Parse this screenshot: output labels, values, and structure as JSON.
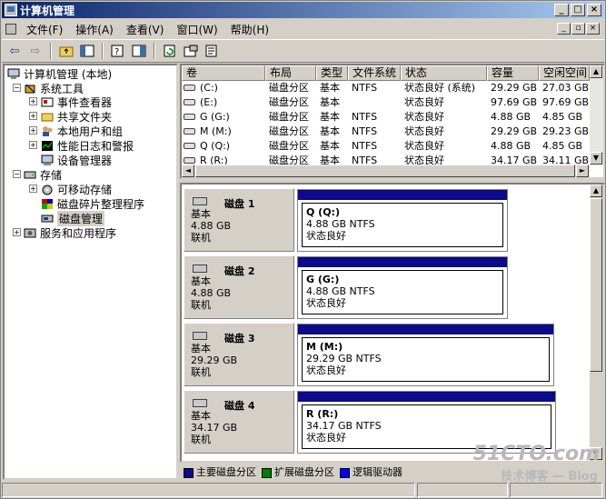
{
  "window": {
    "title": "计算机管理"
  },
  "menu": [
    "文件(F)",
    "操作(A)",
    "查看(V)",
    "窗口(W)",
    "帮助(H)"
  ],
  "tree": {
    "root": "计算机管理 (本地)",
    "system_tools": "系统工具",
    "event_viewer": "事件查看器",
    "shared_folders": "共享文件夹",
    "local_users": "本地用户和组",
    "perf_logs": "性能日志和警报",
    "device_manager": "设备管理器",
    "storage": "存储",
    "removable": "可移动存储",
    "defrag": "磁盘碎片整理程序",
    "disk_mgmt": "磁盘管理",
    "services": "服务和应用程序"
  },
  "columns": [
    "卷",
    "布局",
    "类型",
    "文件系统",
    "状态",
    "容量",
    "空闲空间"
  ],
  "rows": [
    [
      "(C:)",
      "磁盘分区",
      "基本",
      "NTFS",
      "状态良好 (系统)",
      "29.29 GB",
      "27.03 GB"
    ],
    [
      "(E:)",
      "磁盘分区",
      "基本",
      "",
      "状态良好",
      "97.69 GB",
      "97.69 GB"
    ],
    [
      "G (G:)",
      "磁盘分区",
      "基本",
      "NTFS",
      "状态良好",
      "4.88 GB",
      "4.85 GB"
    ],
    [
      "M (M:)",
      "磁盘分区",
      "基本",
      "NTFS",
      "状态良好",
      "29.29 GB",
      "29.23 GB"
    ],
    [
      "Q (Q:)",
      "磁盘分区",
      "基本",
      "NTFS",
      "状态良好",
      "4.88 GB",
      "4.85 GB"
    ],
    [
      "R (R:)",
      "磁盘分区",
      "基本",
      "NTFS",
      "状态良好",
      "34.17 GB",
      "34.11 GB"
    ]
  ],
  "disks": [
    {
      "name": "磁盘 1",
      "type": "基本",
      "size": "4.88 GB",
      "state": "联机",
      "vol_label": "Q  (Q:)",
      "vol_size": "4.88 GB NTFS",
      "vol_status": "状态良好"
    },
    {
      "name": "磁盘 2",
      "type": "基本",
      "size": "4.88 GB",
      "state": "联机",
      "vol_label": "G  (G:)",
      "vol_size": "4.88 GB NTFS",
      "vol_status": "状态良好"
    },
    {
      "name": "磁盘 3",
      "type": "基本",
      "size": "29.29 GB",
      "state": "联机",
      "vol_label": "M  (M:)",
      "vol_size": "29.29 GB NTFS",
      "vol_status": "状态良好"
    },
    {
      "name": "磁盘 4",
      "type": "基本",
      "size": "34.17 GB",
      "state": "联机",
      "vol_label": "R  (R:)",
      "vol_size": "34.17 GB NTFS",
      "vol_status": "状态良好"
    }
  ],
  "legend": [
    {
      "label": "主要磁盘分区",
      "color": "#0a0a8a"
    },
    {
      "label": "扩展磁盘分区",
      "color": "#008000"
    },
    {
      "label": "逻辑驱动器",
      "color": "#0000ff"
    }
  ],
  "watermark": {
    "line1": "51CTO.com",
    "line2": "技术博客",
    "line3": "Blog"
  }
}
